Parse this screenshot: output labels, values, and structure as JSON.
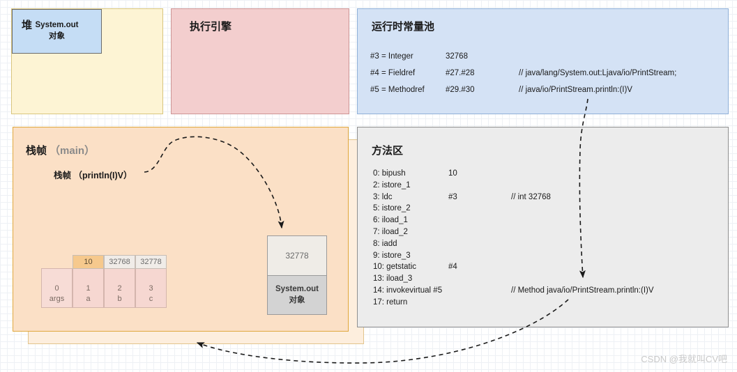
{
  "diagram": {
    "watermark": "CSDN @我就叫CV吧"
  },
  "heap": {
    "title": "堆",
    "object": {
      "line1": "System.out",
      "line2": "对象"
    }
  },
  "execution_engine": {
    "title": "执行引擎"
  },
  "runtime_constant_pool": {
    "title": "运行时常量池",
    "entries": [
      {
        "ref": "#3 = Integer",
        "value": "32768",
        "comment": ""
      },
      {
        "ref": "#4 = Fieldref",
        "value": "#27.#28",
        "comment": "// java/lang/System.out:Ljava/io/PrintStream;"
      },
      {
        "ref": "#5 = Methodref",
        "value": "#29.#30",
        "comment": "// java/io/PrintStream.println:(I)V"
      }
    ]
  },
  "stack": {
    "frame_main_title": "栈帧",
    "frame_main_sub": "（main）",
    "frame_println_title": "栈帧 （println(I)V）",
    "local_variable_table": [
      {
        "index": "0",
        "name": "args",
        "value": "",
        "accent": false
      },
      {
        "index": "1",
        "name": "a",
        "value": "10",
        "accent": true
      },
      {
        "index": "2",
        "name": "b",
        "value": "32768",
        "accent": false
      },
      {
        "index": "3",
        "name": "c",
        "value": "32778",
        "accent": false
      }
    ],
    "operand_stack": {
      "top_value": "32778",
      "object_line1": "System.out",
      "object_line2": "对象"
    }
  },
  "method_area": {
    "title": "方法区",
    "bytecode": [
      {
        "op": "0: bipush",
        "arg": "10",
        "comment": ""
      },
      {
        "op": "2: istore_1",
        "arg": "",
        "comment": ""
      },
      {
        "op": "3: ldc",
        "arg": "#3",
        "comment": "// int 32768"
      },
      {
        "op": "5: istore_2",
        "arg": "",
        "comment": ""
      },
      {
        "op": "6: iload_1",
        "arg": "",
        "comment": ""
      },
      {
        "op": "7: iload_2",
        "arg": "",
        "comment": ""
      },
      {
        "op": "8: iadd",
        "arg": "",
        "comment": ""
      },
      {
        "op": "9: istore_3",
        "arg": "",
        "comment": ""
      },
      {
        "op": "10: getstatic",
        "arg": "#4",
        "comment": ""
      },
      {
        "op": "13: iload_3",
        "arg": "",
        "comment": ""
      },
      {
        "op": "14: invokevirtual #5",
        "arg": "",
        "comment": "// Method java/io/PrintStream.println:(I)V"
      },
      {
        "op": "17: return",
        "arg": "",
        "comment": ""
      }
    ]
  },
  "colors": {
    "heap_fill": "#fdf4d4",
    "engine_fill": "#f3cece",
    "rcp_fill": "#d4e2f5",
    "stack_fill": "#fbe0c6",
    "method_area_fill": "#ececec",
    "object_fill": "#c5ddf5",
    "accent_cell": "#f6c98d"
  }
}
